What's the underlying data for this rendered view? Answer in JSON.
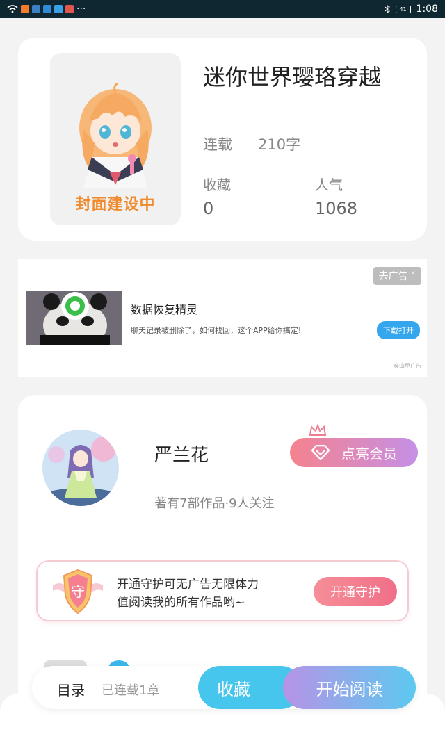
{
  "status_bar": {
    "time": "1:08",
    "battery": "41",
    "more": "···"
  },
  "book": {
    "title": "迷你世界璎珞穿越",
    "cover_caption": "封面建设中",
    "status": "连载",
    "word_count": "210字",
    "favorites_label": "收藏",
    "favorites_value": "0",
    "popularity_label": "人气",
    "popularity_value": "1068"
  },
  "ad": {
    "close_label": "去广告",
    "title": "数据恢复精灵",
    "description": "聊天记录被删除了，如何找回，这个APP给你搞定!",
    "download_label": "下载打开",
    "source": "穿山甲广告"
  },
  "author": {
    "name": "严兰花",
    "stats": "著有7部作品·9人关注",
    "vip_label": "点亮会员",
    "guard_badge": "守",
    "guard_line1": "开通守护可无广告无限体力",
    "guard_line2": "值阅读我的所有作品哟~",
    "guard_button": "开通守护"
  },
  "bottom_bar": {
    "toc_label": "目录",
    "chapter_count": "已连载1章",
    "collect_label": "收藏",
    "read_label": "开始阅读"
  },
  "colors": {
    "accent_blue": "#46c6ec",
    "vip_gradient_start": "#f5828e",
    "vip_gradient_end": "#c590e6",
    "cover_caption": "#f08a2c"
  }
}
